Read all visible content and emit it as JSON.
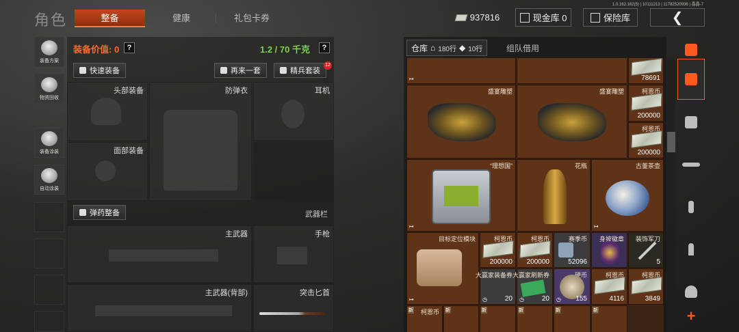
{
  "header": {
    "title": "角色",
    "tabs": [
      {
        "label": "整备",
        "active": true
      },
      {
        "label": "健康",
        "active": false
      },
      {
        "label": "礼包卡券",
        "active": false
      }
    ],
    "version": "1.0.162.162(5) | 10111213 | 11782520936 | 晶晶-7",
    "currency_amount": "937816",
    "cash_vault_label": "现金库 0",
    "safe_label": "保险库",
    "back_icon": "chevron-left-icon"
  },
  "sidebar": {
    "items": [
      {
        "label": "装备方案",
        "icon": "loadout-icon"
      },
      {
        "label": "物资回收",
        "icon": "recycle-icon"
      },
      {
        "label": "装备涂装",
        "icon": "paint-icon"
      },
      {
        "label": "自动涂装",
        "icon": "auto-paint-icon"
      }
    ]
  },
  "equipment": {
    "value_label": "装备价值: 0",
    "help": "?",
    "weight": "1.2 / 70 千克",
    "quick_equip": "快速装备",
    "again": "再来一套",
    "elite": "精兵套装",
    "elite_badge": "12",
    "slots": {
      "head": "头部装备",
      "armor": "防弹衣",
      "earphone": "耳机",
      "face": "面部装备",
      "ammo": "弹药整备",
      "weapon_bar": "武器栏",
      "primary": "主武器",
      "pistol": "手枪",
      "primary_back": "主武器(背部)",
      "knife": "突击匕首"
    }
  },
  "inventory": {
    "warehouse_tab": "仓库",
    "rows_a": "180行",
    "rows_b": "10行",
    "borrow_tab": "组队借用",
    "items": {
      "sculpture_name": "盛宴雕塑",
      "kern": "柯恩币",
      "kern_top": "78691",
      "kern_200000": "200000",
      "ideal_state": "“理想国”",
      "vase": "花瓶",
      "teapot": "古董茶壶",
      "target_module": "目标定位模块",
      "season_coin": "赛季币",
      "season_count": "52096",
      "badge_name": "身披徽章",
      "knife_name": "装饰军刀",
      "knife_count": "5",
      "winner_equip": "大赢家装备券",
      "winner_refresh": "大赢家刷新券",
      "coupon_count": "20",
      "silver_coin": "硬币",
      "silver_count": "155",
      "kern_4116": "4116",
      "kern_3849": "3849",
      "new_tag": "新"
    }
  },
  "categories": [
    "all-icon",
    "vest-icon",
    "rifle-icon",
    "mag-icon",
    "ammo-icon",
    "helmet-icon"
  ]
}
